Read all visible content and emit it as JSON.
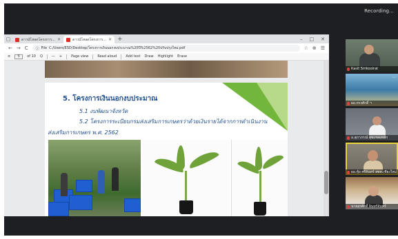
{
  "meeting": {
    "recording_label": "Recording..."
  },
  "browser": {
    "tabs": [
      {
        "label": "ดาวน์โหลดโครงการ...",
        "active": false
      },
      {
        "label": "ดาวน์โหลดโครงการ...",
        "active": true
      }
    ],
    "new_tab": "+",
    "window_controls": [
      "–",
      "□",
      "✕"
    ],
    "nav": [
      "←",
      "→",
      "C"
    ],
    "url_prefix": "File",
    "url": "C:/Users/ESD/Desktop/โครงการเงินนอกงบประมาณ%20ปี%2562%20ปรับปรุงใหม่.pdf",
    "address_icons": [
      "☆",
      "⊕",
      "☰"
    ]
  },
  "pdf_toolbar": {
    "menu": "≡",
    "page_current": "5",
    "page_total": "of 10",
    "search_icon": "Q",
    "zoom_out": "—",
    "zoom_in": "+",
    "page_view": "Page view",
    "read_aloud": "Read aloud",
    "add_text": "Add text",
    "draw": "Draw",
    "highlight": "Highlight",
    "erase": "Erase"
  },
  "slide": {
    "title": "5. โครงการเงินนอกงบประมาณ",
    "item1": "5.1 งบพัฒนาจังหวัด",
    "item2": "5.2 โครงการระเบียบกรมส่งเสริมการเกษตรว่าด้วยเงินรายได้จากการดำเนินงาน",
    "item2_cont": "ส่งเสริมการเกษตร พ.ศ. 2562"
  },
  "participants": [
    {
      "name": "Kasit Sirikoolrat",
      "active": false
    },
    {
      "name": "ผอ.ทรงศักดิ์ ฯ",
      "active": false
    },
    {
      "name": "อ.สุภาภรณ์ สุขเกษมหลัก",
      "active": false
    },
    {
      "name": "ผอ.ทุ้ย ศรีจันทร์ สพค.เชียงใหม่",
      "active": true
    },
    {
      "name": "นายสุรศักดิ์ อินทร์จันทร์",
      "active": false
    }
  ]
}
